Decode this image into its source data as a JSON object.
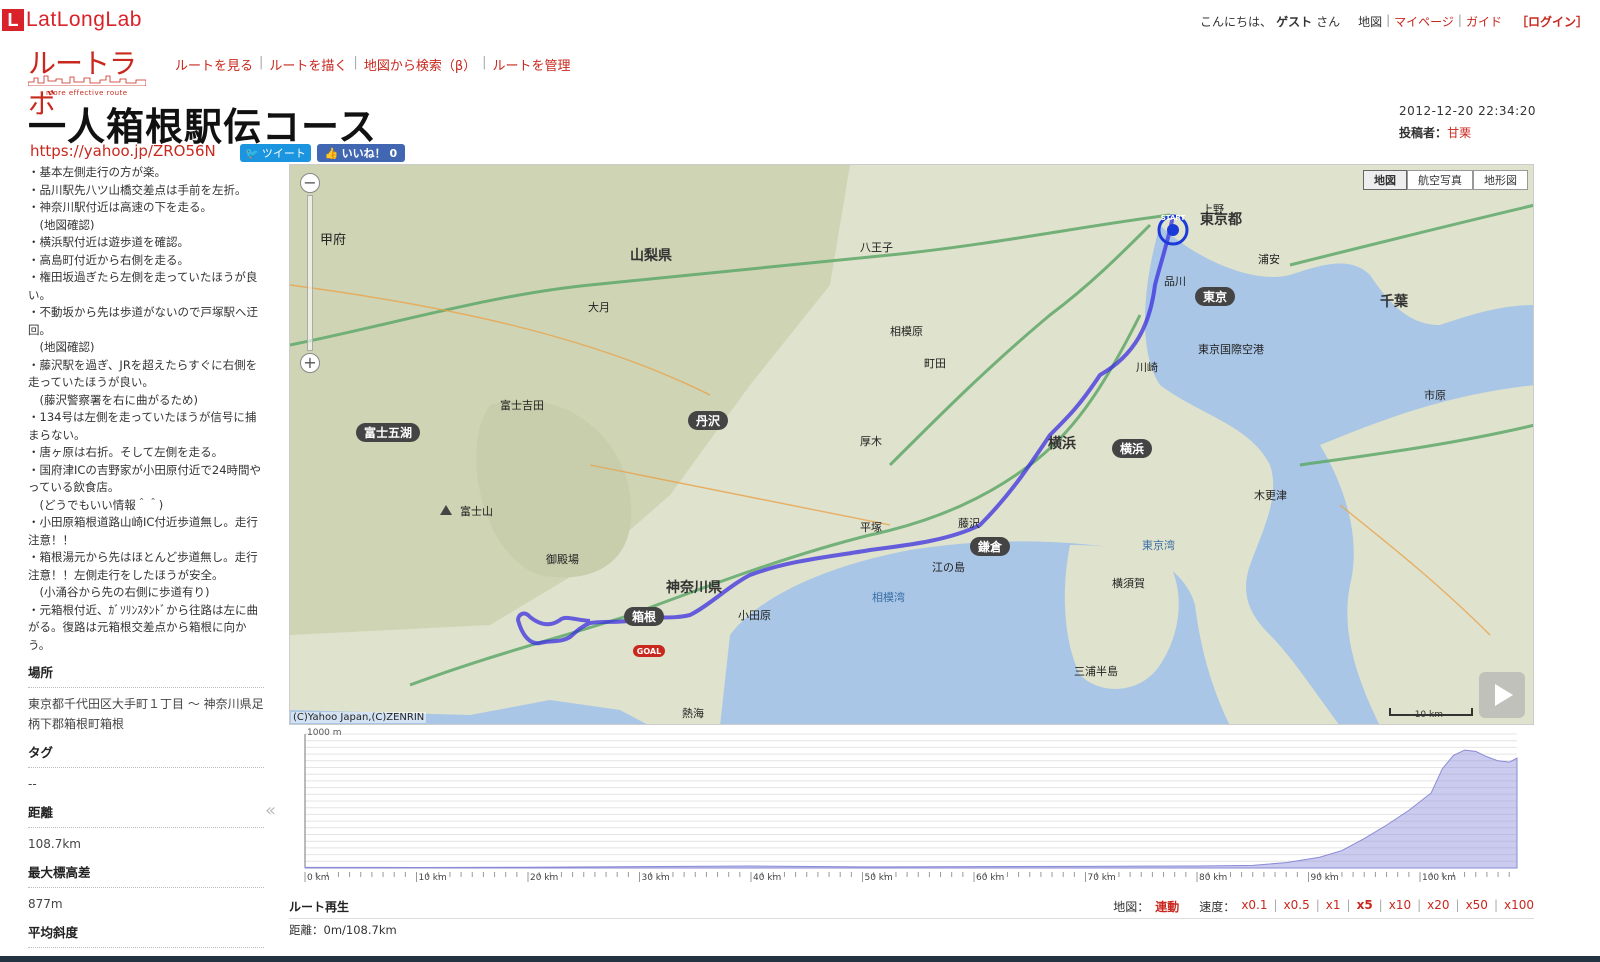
{
  "brand": {
    "latlong_letter": "L",
    "latlong_name": "LatLongLab",
    "routelab_name": "ルートラボ",
    "routelab_tagline": "more effective route"
  },
  "userbar": {
    "greeting": "こんにちは、",
    "user": "ゲスト",
    "suffix": "さん",
    "links": [
      "地図",
      "マイページ",
      "ガイド"
    ],
    "login": "［ログイン］"
  },
  "nav": [
    "ルートを見る",
    "ルートを描く",
    "地図から検索（β）",
    "ルートを管理"
  ],
  "title": "一人箱根駅伝コース",
  "short_url": "https://yahoo.jp/ZRO56N",
  "tweet_label": "ツイート",
  "like_label": "いいね！ 0",
  "meta": {
    "date": "2012-12-20 22:34:20",
    "author_label": "投稿者：",
    "author": "甘栗"
  },
  "notes": [
    "・基本左側走行の方が楽。",
    "・品川駅先八ツ山橋交差点は手前を左折。",
    "・神奈川駅付近は高速の下を走る。",
    "　(地図確認)",
    "・横浜駅付近は遊歩道を確認。",
    "・高島町付近から右側を走る。",
    "・権田坂過ぎたら左側を走っていたほうが良い。",
    "・不動坂から先は歩道がないので戸塚駅へ迂回。",
    "　(地図確認)",
    "・藤沢駅を過ぎ、JRを超えたらすぐに右側を走っていたほうが良い。",
    "　(藤沢警察署を右に曲がるため)",
    "・134号は左側を走っていたほうが信号に捕まらない。",
    "・唐ヶ原は右折。そして左側を走る。",
    "・国府津ICの吉野家が小田原付近で24時間やっている飲食店。",
    "　(どうでもいい情報＾＾)",
    "・小田原箱根道路山崎IC付近歩道無し。走行注意！！",
    "・箱根湯元から先はほとんど歩道無し。走行注意！！左側走行をしたほうが安全。",
    "　(小涌谷から先の右側に歩道有り)",
    "・元箱根付近、ｶﾞｿﾘﾝｽﾀﾝﾄﾞから往路は左に曲がる。復路は元箱根交差点から箱根に向かう。"
  ],
  "place": {
    "label": "場所",
    "value": "東京都千代田区大手町１丁目 ～ 神奈川県足柄下郡箱根町箱根"
  },
  "tags": {
    "label": "タグ",
    "value": "--"
  },
  "distance": {
    "label": "距離",
    "value": "108.7km"
  },
  "max_elev": {
    "label": "最大標高差",
    "value": "877m"
  },
  "avg_grade": {
    "label": "平均斜度"
  },
  "collapse_icon": "«",
  "map": {
    "modes": [
      "地図",
      "航空写真",
      "地形図"
    ],
    "active_mode": "地図",
    "copyright": "(C)Yahoo Japan,(C)ZENRIN",
    "scale": "10 km",
    "labels": [
      {
        "t": "東京都"
      },
      {
        "t": "山梨県"
      },
      {
        "t": "神奈川県"
      },
      {
        "t": "千葉"
      },
      {
        "t": "甲府"
      },
      {
        "t": "大月"
      },
      {
        "t": "富士山"
      },
      {
        "t": "八王子"
      },
      {
        "t": "相模原"
      },
      {
        "t": "横浜"
      },
      {
        "t": "川崎"
      },
      {
        "t": "品川"
      },
      {
        "t": "小田原"
      },
      {
        "t": "藤沢"
      },
      {
        "t": "東京湾"
      },
      {
        "t": "相模湾"
      },
      {
        "t": "木更津"
      },
      {
        "t": "横須賀"
      },
      {
        "t": "三浦半島"
      },
      {
        "t": "江の島"
      },
      {
        "t": "平塚"
      },
      {
        "t": "厚木"
      },
      {
        "t": "町田"
      },
      {
        "t": "上野"
      },
      {
        "t": "市原"
      },
      {
        "t": "富士吉田"
      },
      {
        "t": "御殿場"
      },
      {
        "t": "熱海"
      },
      {
        "t": "浦安"
      },
      {
        "t": "東京国際空港"
      }
    ],
    "badges": [
      "東京",
      "富士五湖",
      "丹沢",
      "横浜",
      "鎌倉",
      "箱根"
    ],
    "start_label": "START",
    "goal_label": "GOAL"
  },
  "chart_data": {
    "type": "area",
    "title": "",
    "xlabel": "",
    "ylabel": "",
    "x_ticks": [
      "0 km",
      "10 km",
      "20 km",
      "30 km",
      "40 km",
      "50 km",
      "60 km",
      "70 km",
      "80 km",
      "90 km",
      "100 km"
    ],
    "ylim_label": "1000 m",
    "ylim": [
      0,
      1000
    ],
    "xlim": [
      0,
      108.7
    ],
    "series": [
      {
        "x": [
          0,
          10,
          20,
          30,
          40,
          50,
          60,
          70,
          80,
          85,
          88,
          91,
          93,
          95,
          97,
          99,
          101,
          102,
          103,
          104,
          105,
          106,
          107,
          108,
          108.7
        ],
        "y": [
          5,
          4,
          6,
          10,
          15,
          8,
          10,
          12,
          15,
          20,
          40,
          80,
          130,
          220,
          320,
          430,
          560,
          740,
          840,
          880,
          870,
          830,
          800,
          790,
          820
        ]
      }
    ]
  },
  "replay": {
    "label": "ルート再生",
    "map_label": "地図：",
    "map_mode": "連動",
    "speed_label": "速度：",
    "speeds": [
      "x0.1",
      "x0.5",
      "x1",
      "x5",
      "x10",
      "x20",
      "x50",
      "x100"
    ],
    "active_speed": "x5",
    "distance_text": "距離：0m/108.7km"
  }
}
